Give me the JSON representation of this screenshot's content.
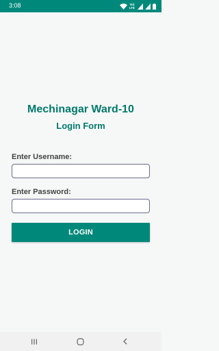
{
  "status_bar": {
    "time": "3:08",
    "icons": [
      "wifi-icon",
      "volte-icon",
      "signal-icon",
      "signal-icon",
      "battery-icon"
    ],
    "vo_text_top": "Vo)",
    "vo_text_bottom": "LTE"
  },
  "app_title": "Mechinagar Ward-10",
  "form_title": "Login Form",
  "username": {
    "label": "Enter Username:",
    "value": ""
  },
  "password": {
    "label": "Enter Password:",
    "value": ""
  },
  "login_button_label": "LOGIN",
  "nav_bar": {
    "icons": [
      "recents-icon",
      "home-icon",
      "back-icon"
    ]
  },
  "colors": {
    "primary": "#00897b",
    "title_text": "#00796b",
    "background": "#f6f8f8"
  }
}
